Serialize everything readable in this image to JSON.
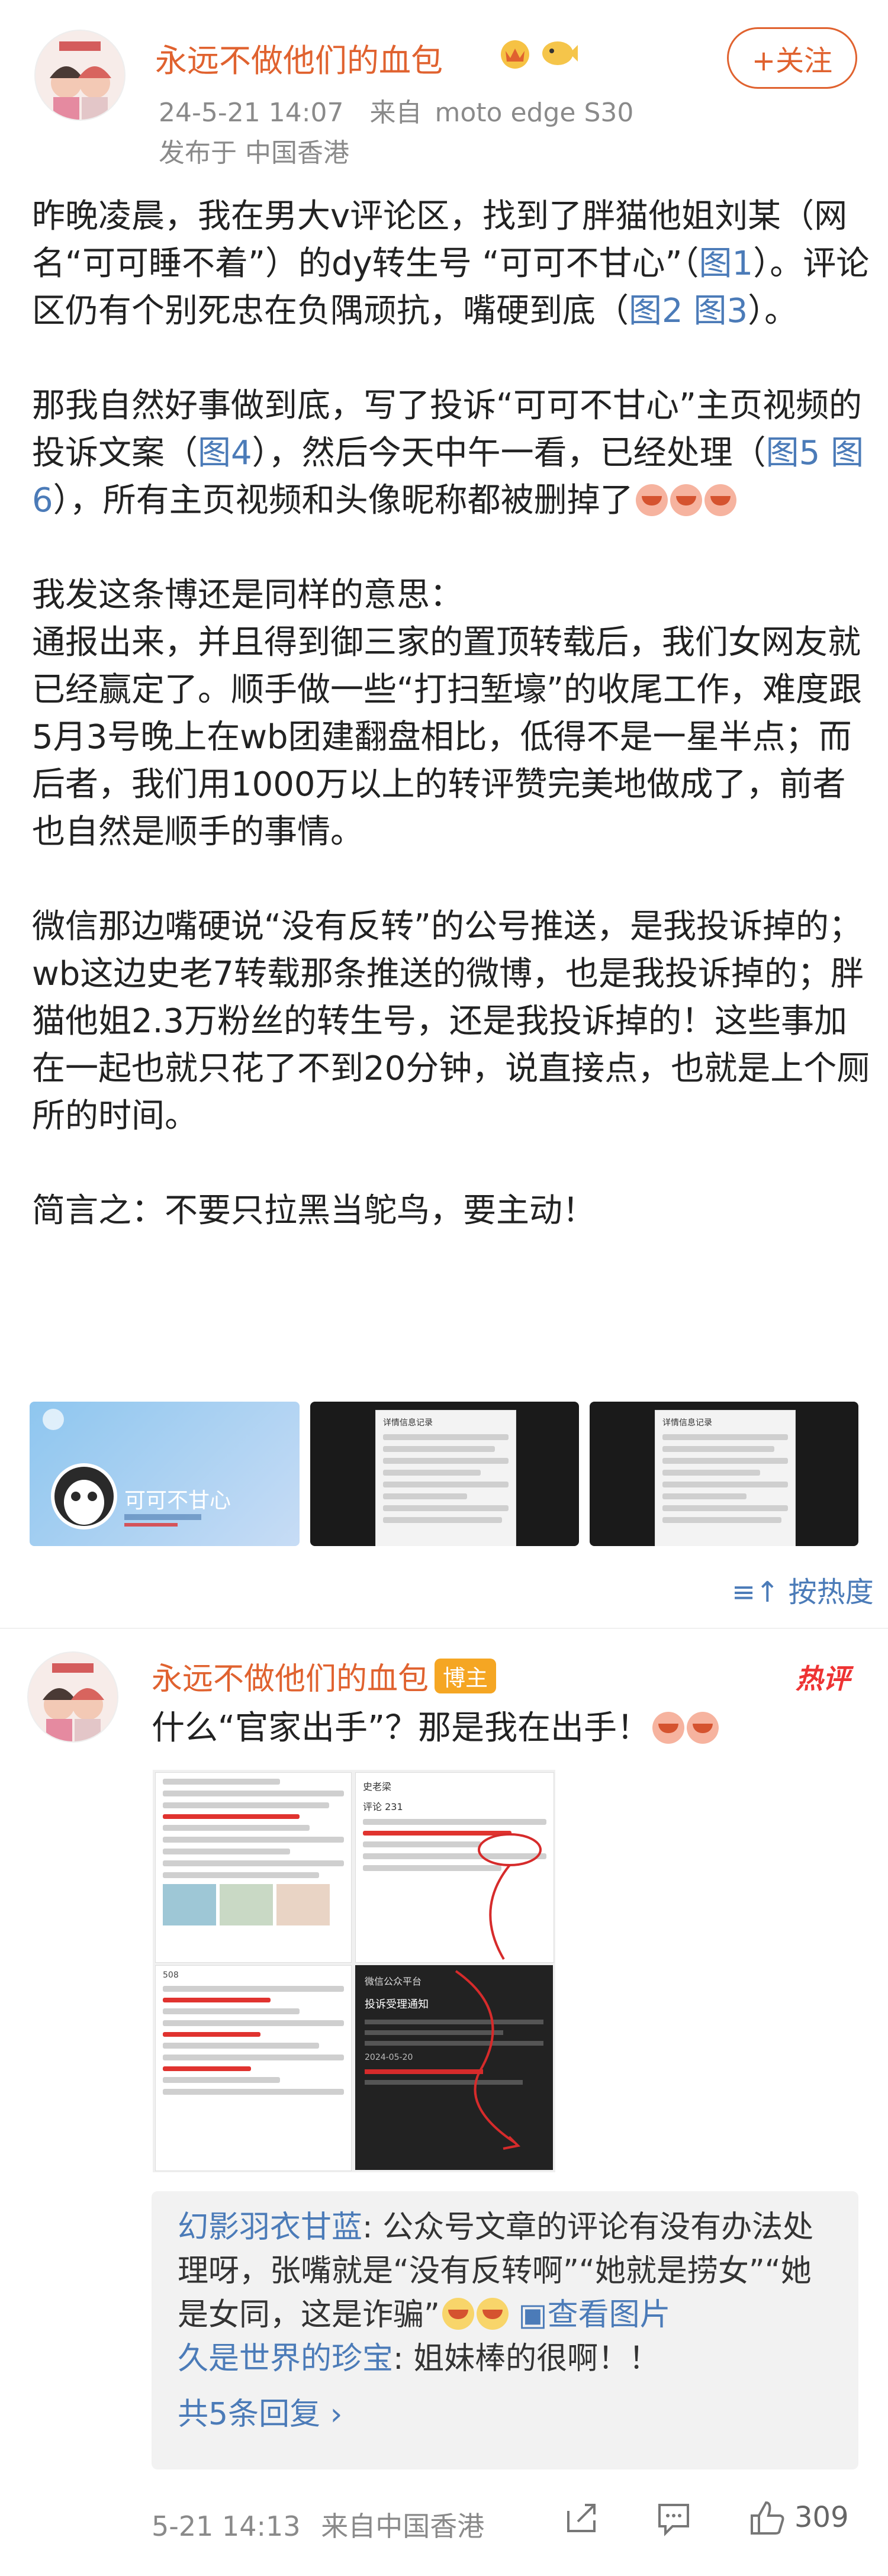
{
  "post": {
    "username": "永远不做他们的血包",
    "timestamp": "24-5-21 14:07",
    "source_prefix": "来自",
    "device": "moto edge S30",
    "location": "发布于 中国香港",
    "follow_label": "+关注",
    "paragraphs": [
      [
        "昨晚凌晨，我在男大v评论区，找到了胖猫他姐刘某（网名“可可睡不着”）的dy转生号 “可可不甘心”（",
        "图1",
        "）。评论区仍有个别死忠在负隅顽抗，嘴硬到底（",
        "图2",
        " ",
        "图3",
        "）。"
      ],
      [
        "那我自然好事做到底，写了投诉“可可不甘心”主页视频的投诉文案（",
        "图4",
        "），然后今天中午一看，已经处理（",
        "图5",
        " ",
        "图6",
        "），所有主页视频和头像昵称都被删掉了"
      ],
      [
        "我发这条博还是同样的意思："
      ],
      [
        "通报出来，并且得到御三家的置顶转载后，我们女网友就已经赢定了。顺手做一些“打扫堑壕”的收尾工作，难度跟5月3号晚上在wb团建翻盘相比，低得不是一星半点；而后者，我们用1000万以上的转评赞完美地做成了，前者也自然是顺手的事情。"
      ],
      [
        "微信那边嘴硬说“没有反转”的公号推送，是我投诉掉的；wb这边史老7转载那条推送的微博，也是我投诉掉的；胖猫他姐2.3万粉丝的转生号，还是我投诉掉的！这些事加在一起也就只花了不到20分钟，说直接点，也就是上个厕所的时间。"
      ],
      [
        "简言之：不要只拉黑当鸵鸟，要主动！"
      ]
    ],
    "thumb1_name": "可可不甘心",
    "thumb2_title": "详情信息记录",
    "thumb3_title": "详情信息记录"
  },
  "sort_label": "按热度",
  "comment": {
    "username": "永远不做他们的血包",
    "badge": "博主",
    "hot_label": "热评",
    "text": "什么“官家出手”？那是我在出手！",
    "shot_comments_label": "评论 231",
    "shot_reply_count": "508",
    "shot_user": "史老梁",
    "shot_notice_title": "投诉受理通知",
    "shot_wechat": "微信公众平台",
    "shot_date": "2024-05-20",
    "replies": [
      {
        "name": "幻影羽衣甘蓝",
        "text": "公众号文章的评论有没有办法处理呀，张嘴就是“没有反转啊”“她就是捞女”“她是女同，这是诈骗”",
        "view_image": "查看图片"
      },
      {
        "name": "久是世界的珍宝",
        "text": "姐妹棒的很啊！！"
      }
    ],
    "more_replies": "共5条回复 ›",
    "time": "5-21 14:13",
    "source": "来自中国香港",
    "like_count": "309"
  },
  "colors": {
    "accent": "#e0622f",
    "link": "#4b7bb8",
    "hot": "#e33333"
  }
}
